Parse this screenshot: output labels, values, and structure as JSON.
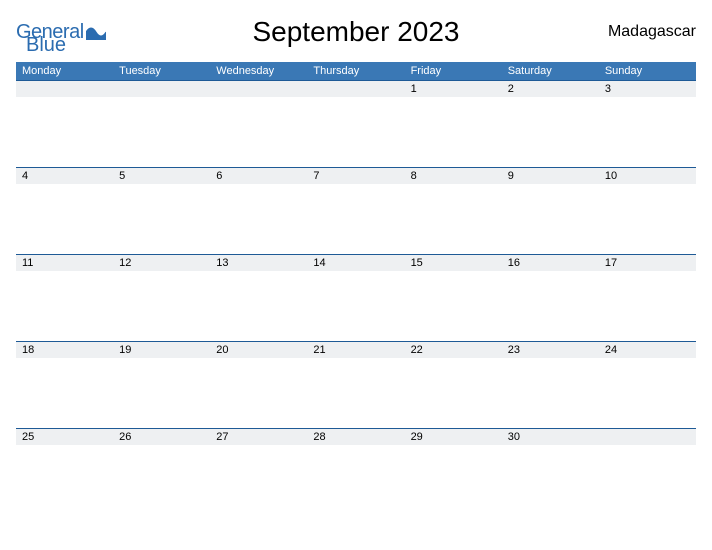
{
  "header": {
    "logo_text_1": "General",
    "logo_text_2": "Blue",
    "title": "September 2023",
    "country": "Madagascar"
  },
  "days": {
    "d0": "Monday",
    "d1": "Tuesday",
    "d2": "Wednesday",
    "d3": "Thursday",
    "d4": "Friday",
    "d5": "Saturday",
    "d6": "Sunday"
  },
  "weeks": {
    "w0": {
      "c0": "",
      "c1": "",
      "c2": "",
      "c3": "",
      "c4": "1",
      "c5": "2",
      "c6": "3"
    },
    "w1": {
      "c0": "4",
      "c1": "5",
      "c2": "6",
      "c3": "7",
      "c4": "8",
      "c5": "9",
      "c6": "10"
    },
    "w2": {
      "c0": "11",
      "c1": "12",
      "c2": "13",
      "c3": "14",
      "c4": "15",
      "c5": "16",
      "c6": "17"
    },
    "w3": {
      "c0": "18",
      "c1": "19",
      "c2": "20",
      "c3": "21",
      "c4": "22",
      "c5": "23",
      "c6": "24"
    },
    "w4": {
      "c0": "25",
      "c1": "26",
      "c2": "27",
      "c3": "28",
      "c4": "29",
      "c5": "30",
      "c6": ""
    }
  }
}
